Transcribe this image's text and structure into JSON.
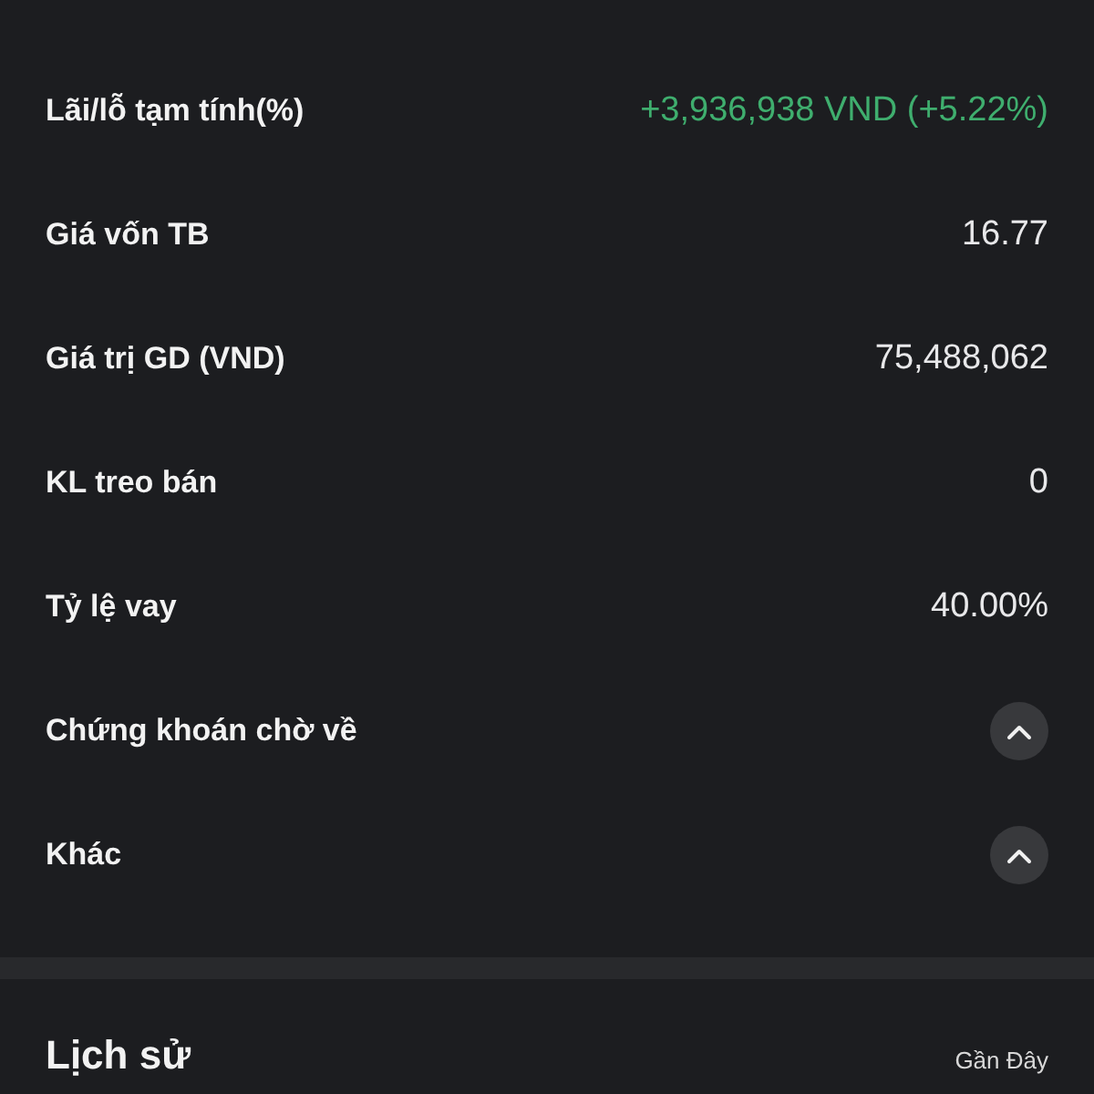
{
  "rows": [
    {
      "kind": "gain",
      "label": "Lãi/lỗ tạm tính(%)",
      "value": "+3,936,938 VND (+5.22%)"
    },
    {
      "kind": "value",
      "label": "Giá vốn TB",
      "value": "16.77"
    },
    {
      "kind": "value",
      "label": "Giá trị GD (VND)",
      "value": "75,488,062"
    },
    {
      "kind": "value",
      "label": "KL treo bán",
      "value": "0"
    },
    {
      "kind": "value",
      "label": "Tỷ lệ vay",
      "value": "40.00%"
    },
    {
      "kind": "expandable",
      "label": "Chứng khoán chờ về"
    },
    {
      "kind": "expandable",
      "label": "Khác"
    }
  ],
  "history": {
    "title": "Lịch sử",
    "link": "Gần Đây"
  }
}
